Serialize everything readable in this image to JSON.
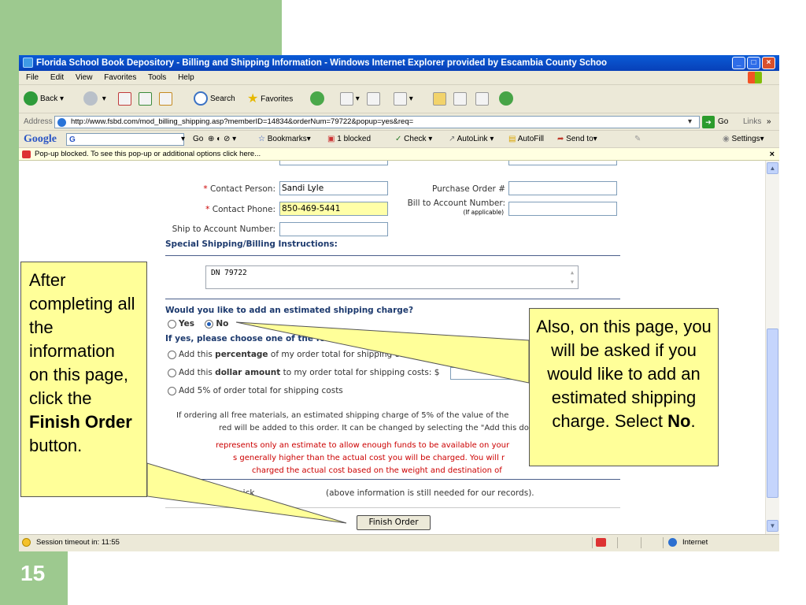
{
  "slide": {
    "number": "15"
  },
  "window": {
    "title": "Florida School Book Depository - Billing and Shipping Information - Windows Internet Explorer provided by Escambia County Schoo",
    "controls": {
      "minimize": "_",
      "maximize": "□",
      "close": "×"
    }
  },
  "menu": [
    "File",
    "Edit",
    "View",
    "Favorites",
    "Tools",
    "Help"
  ],
  "toolbar": {
    "back": "Back",
    "search": "Search",
    "favorites": "Favorites"
  },
  "address": {
    "label": "Address",
    "url": "http://www.fsbd.com/mod_billing_shipping.asp?memberID=14834&orderNum=79722&popup=yes&req=",
    "go": "Go",
    "links": "Links"
  },
  "google": {
    "logo": "Google",
    "g": "G",
    "go": "Go",
    "bookmarks": "Bookmarks",
    "blocked": "1 blocked",
    "check": "Check",
    "autolink": "AutoLink",
    "autofill": "AutoFill",
    "sendto": "Send to",
    "settings": "Settings"
  },
  "popup": {
    "message": "Pop-up blocked. To see this pop-up or additional options click here..."
  },
  "form": {
    "contact_person": {
      "label": "Contact Person:",
      "value": "Sandi Lyle"
    },
    "contact_phone": {
      "label": "Contact Phone:",
      "value": "850-469-5441"
    },
    "po": {
      "label": "Purchase Order #",
      "value": ""
    },
    "bill_to": {
      "label": "Bill to Account Number:",
      "sub": "(If applicable)",
      "value": ""
    },
    "ship_to": {
      "label": "Ship to Account Number:",
      "value": ""
    },
    "instructions": {
      "title": "Special Shipping/Billing Instructions:",
      "value": "DN 79722"
    },
    "shipping_question": "Would you like to add an estimated shipping charge?",
    "yes": "Yes",
    "no": "No",
    "yes_choose": "If yes, please choose one of the fo",
    "opt_pct_pre": "Add this ",
    "opt_pct_bold": "percentage",
    "opt_pct_post": " of my order total for shipping co",
    "opt_dollar_pre": "Add this ",
    "opt_dollar_bold": "dollar amount",
    "opt_dollar_post": " to my order total for shipping costs:  $",
    "opt_5pct": "Add 5% of order total for shipping costs",
    "note_1": "If ordering all free materials, an estimated shipping charge of 5% of the value of the",
    "note_2": "red will be added to this order. It can be changed by selecting the \"Add this do",
    "red_1": "represents only an estimate to allow enough funds to be available on your",
    "red_2": "s generally higher than the actual cost you will be charged. You will r",
    "red_3": "charged the actual cost based on the weight and destination of",
    "pickup_pre": "Customer will pick",
    "pickup_post": "(above information is still needed for our records).",
    "finish": "Finish Order"
  },
  "status": {
    "text": "Session timeout in: 11:55",
    "zone": "Internet"
  },
  "callouts": {
    "left_pre": "After completing all the information on this page, click the ",
    "left_bold": "Finish Order",
    "left_post": " button.",
    "right_pre": "Also, on this page, you will be asked if you would like to add an estimated shipping charge. Select ",
    "right_bold": "No",
    "right_post": "."
  }
}
